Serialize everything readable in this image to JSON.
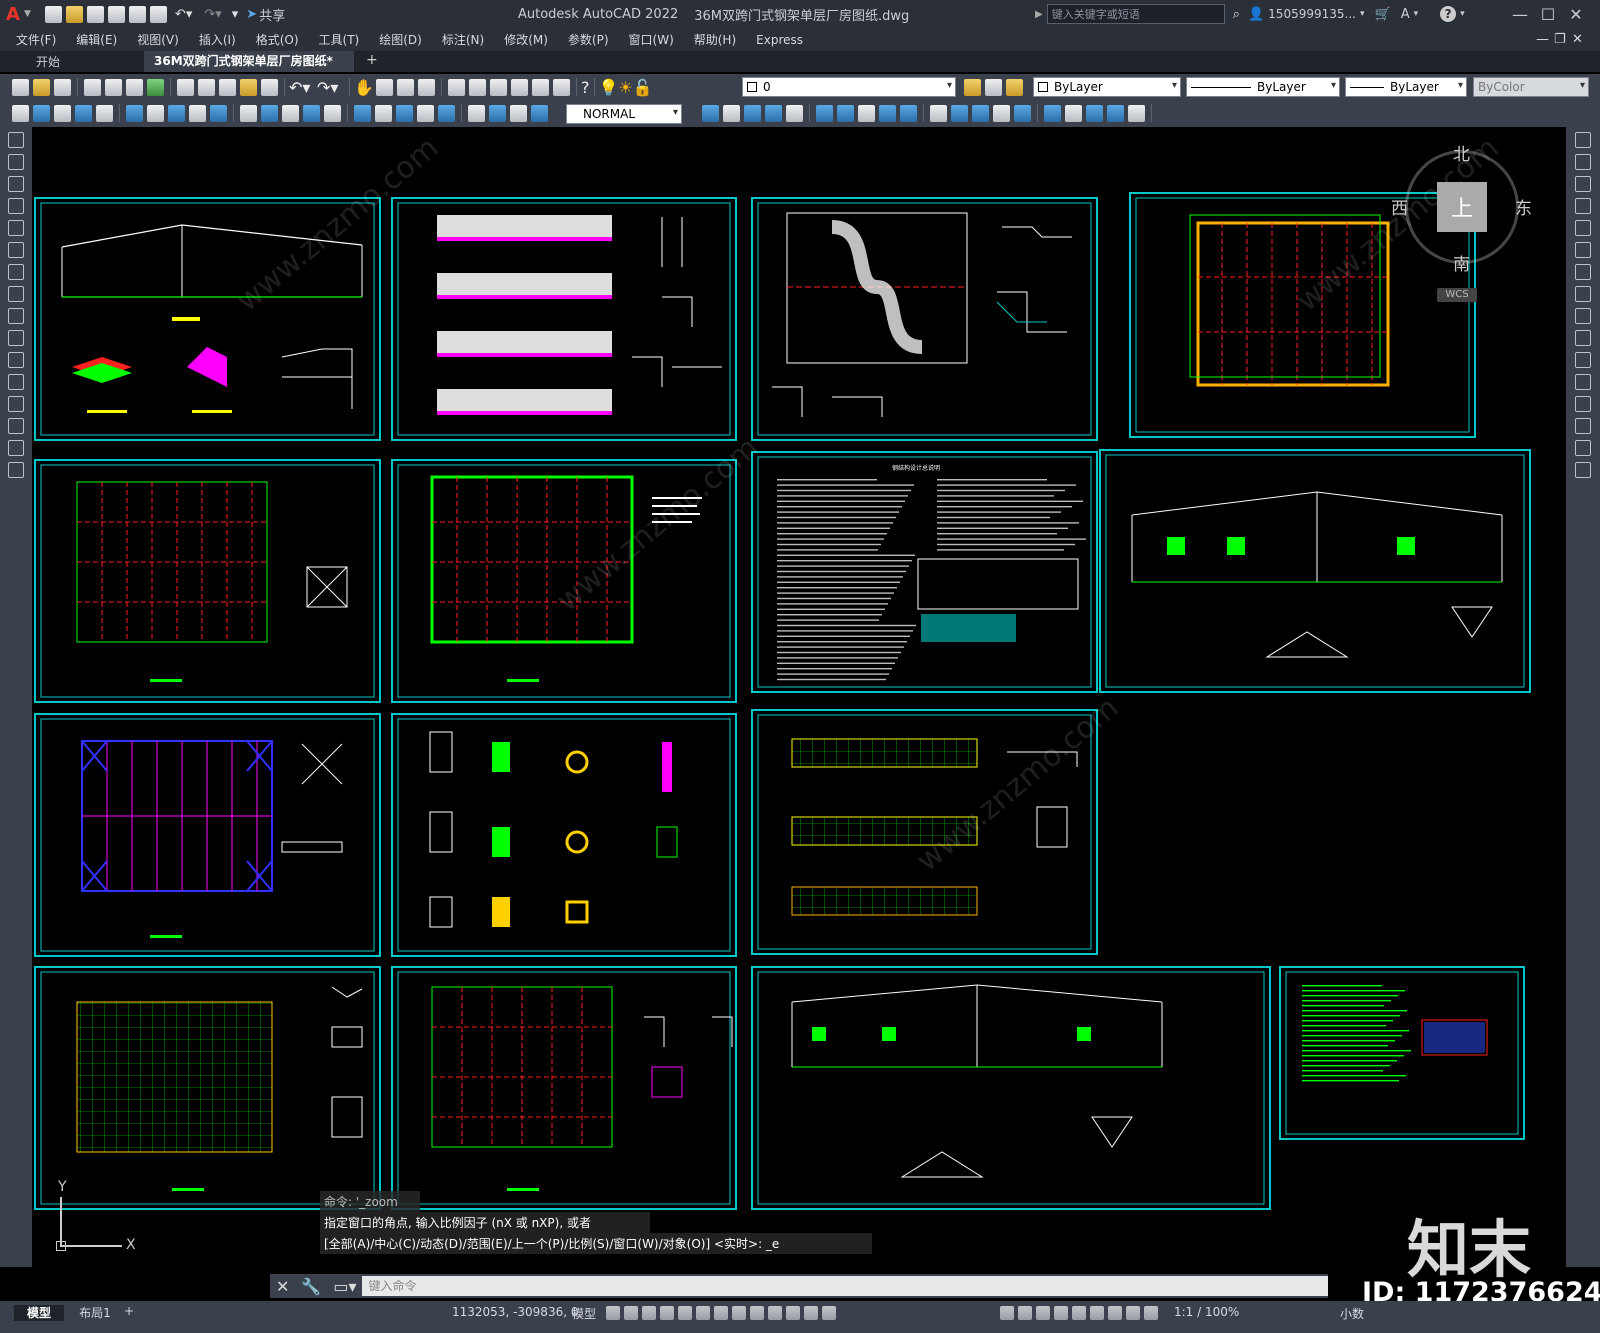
{
  "titlebar": {
    "app_logo": "A",
    "share_label": "共享",
    "title": "Autodesk AutoCAD 2022",
    "filename": "36M双跨门式钢架单层厂房图纸.dwg",
    "search_placeholder": "键入关键字或短语",
    "user": "1505999135...",
    "icons": [
      "new-icon",
      "open-icon",
      "save-icon",
      "saveas-icon",
      "plot-icon",
      "undo-icon",
      "redo-icon"
    ]
  },
  "menubar": {
    "items": [
      "文件(F)",
      "编辑(E)",
      "视图(V)",
      "插入(I)",
      "格式(O)",
      "工具(T)",
      "绘图(D)",
      "标注(N)",
      "修改(M)",
      "参数(P)",
      "窗口(W)",
      "帮助(H)",
      "Express"
    ]
  },
  "tabs": {
    "items": [
      {
        "label": "开始",
        "active": false
      },
      {
        "label": "36M双跨门式钢架单层厂房图纸*",
        "active": true
      }
    ],
    "close_glyph": "×",
    "add_glyph": "+"
  },
  "toolbar": {
    "layer_value": "0",
    "linetype_label": "ByLayer",
    "layer_prop": "ByLayer",
    "lineweight": "ByLayer",
    "color": "ByColor",
    "dimstyle": "NORMAL"
  },
  "viewcube": {
    "north": "北",
    "south": "南",
    "east": "东",
    "west": "西",
    "face": "上",
    "wcs": "WCS"
  },
  "command": {
    "line1": "命令:  '_zoom",
    "line2": "指定窗口的角点, 输入比例因子 (nX 或 nXP), 或者",
    "line3": "[全部(A)/中心(C)/动态(D)/范围(E)/上一个(P)/比例(S)/窗口(W)/对象(O)] <实时>: _e",
    "input_placeholder": "键入命令"
  },
  "ucs": {
    "y": "Y",
    "x": "X"
  },
  "layout_tabs": [
    "模型",
    "布局1"
  ],
  "status": {
    "coords": "1132053, -309836, 0",
    "model": "模型",
    "scale": "1:1 / 100%",
    "units": "小数"
  },
  "watermark": {
    "logo": "知末",
    "id": "ID: 1172376624",
    "site": "www.znzmo.com"
  },
  "drawing": {
    "general_notes_title": "钢结构设计总说明",
    "notes_title_2": "结构设计总说明"
  },
  "colors": {
    "frame": "#00c8c8",
    "green": "#00ff00",
    "red": "#ff2020",
    "magenta": "#ff00ff",
    "yellow": "#ffff00",
    "bg": "#000000",
    "ui": "#3b414c"
  }
}
